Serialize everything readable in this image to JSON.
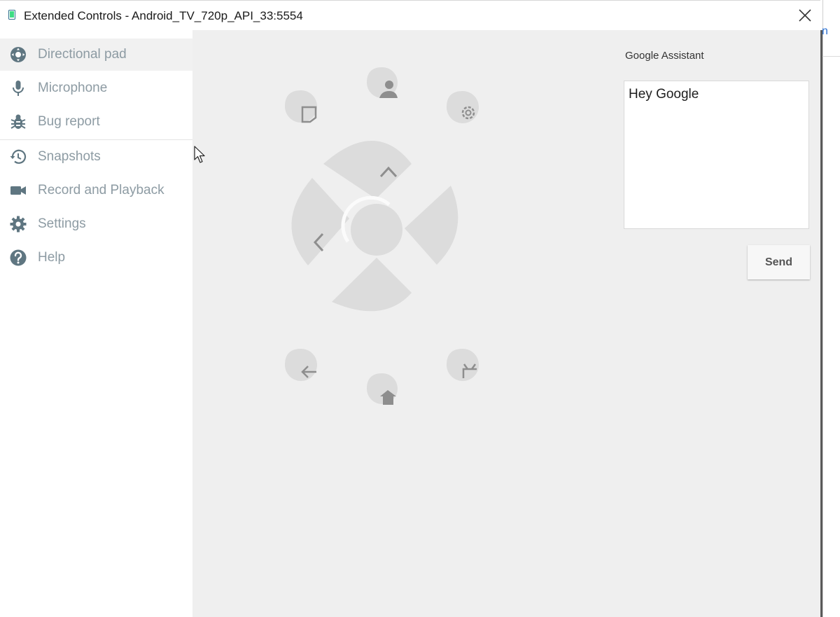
{
  "window": {
    "title": "Extended Controls - Android_TV_720p_API_33:5554",
    "close_icon": "close-icon"
  },
  "sidebar": {
    "items": [
      {
        "label": "Directional pad",
        "icon": "dpad-icon",
        "active": true
      },
      {
        "label": "Microphone",
        "icon": "microphone-icon"
      },
      {
        "label": "Bug report",
        "icon": "bug-icon"
      },
      {
        "label": "Snapshots",
        "icon": "history-icon"
      },
      {
        "label": "Record and Playback",
        "icon": "videocam-icon"
      },
      {
        "label": "Settings",
        "icon": "gear-icon"
      },
      {
        "label": "Help",
        "icon": "help-icon"
      }
    ]
  },
  "dpad": {
    "buttons": [
      "profile-icon",
      "bookmark-icon",
      "gear-icon",
      "chevron-up-icon",
      "chevron-left-icon",
      "back-arrow-icon",
      "home-icon",
      "tv-icon"
    ]
  },
  "assistant": {
    "label": "Google Assistant",
    "text": "Hey Google",
    "send_label": "Send"
  },
  "colors": {
    "sidebar_text": "#8d9ba3",
    "sidebar_icon": "#5f7681",
    "panel_bg": "#efefef",
    "dpad_fill": "#dcdcdc",
    "dpad_arrow": "#8e8e8e",
    "active_row": "#f1f1f1"
  }
}
